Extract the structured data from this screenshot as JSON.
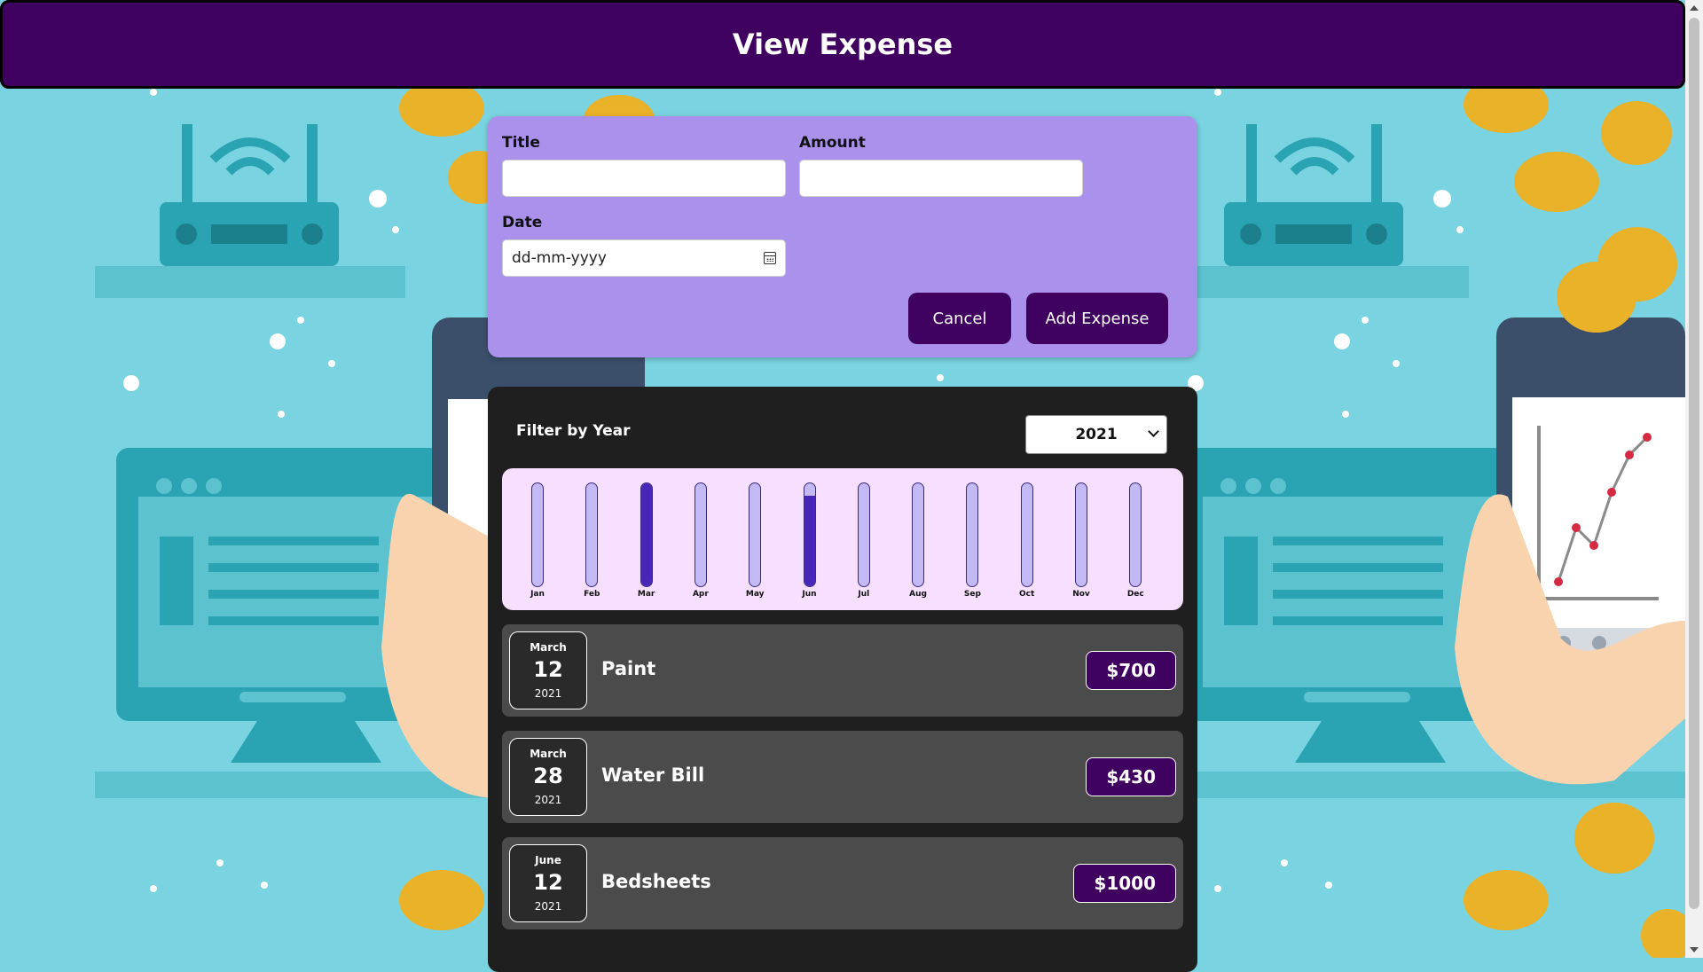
{
  "header": {
    "title": "View Expense"
  },
  "form": {
    "title_label": "Title",
    "title_value": "",
    "amount_label": "Amount",
    "amount_value": "",
    "date_label": "Date",
    "date_placeholder": "dd-mm-yyyy",
    "cancel_label": "Cancel",
    "add_label": "Add Expense"
  },
  "filter": {
    "label": "Filter by Year",
    "selected_year": "2021"
  },
  "chart_data": {
    "type": "bar",
    "categories": [
      "Jan",
      "Feb",
      "Mar",
      "Apr",
      "May",
      "Jun",
      "Jul",
      "Aug",
      "Sep",
      "Oct",
      "Nov",
      "Dec"
    ],
    "values": [
      0,
      0,
      1130,
      0,
      0,
      1000,
      0,
      0,
      0,
      0,
      0,
      0
    ],
    "ylim": [
      0,
      1130
    ],
    "colors": {
      "track": "#c3b9f5",
      "fill": "#4826b9",
      "background": "#f7dfff"
    }
  },
  "expenses": [
    {
      "month": "March",
      "day": "12",
      "year": "2021",
      "title": "Paint",
      "amount": "$700"
    },
    {
      "month": "March",
      "day": "28",
      "year": "2021",
      "title": "Water Bill",
      "amount": "$430"
    },
    {
      "month": "June",
      "day": "12",
      "year": "2021",
      "title": "Bedsheets",
      "amount": "$1000"
    }
  ],
  "colors": {
    "header_bg": "#3f0060",
    "form_bg": "#a991ec",
    "panel_bg": "#1f1f1f",
    "item_bg": "#4b4b4b",
    "page_bg": "#79d3e0"
  }
}
